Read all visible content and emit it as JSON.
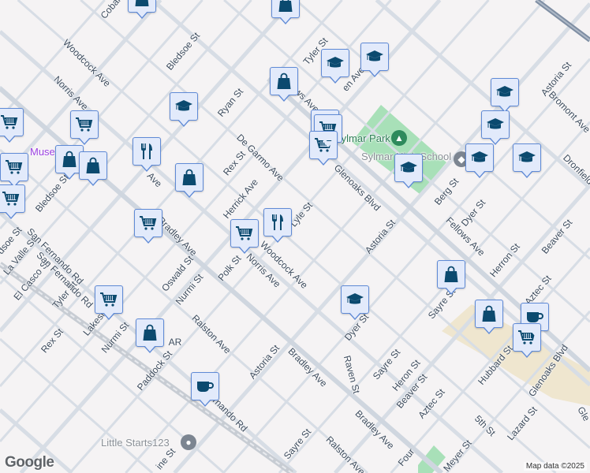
{
  "map": {
    "labels": [
      "Cobal",
      "Tyler St",
      "Bledsoe St",
      "Woodcock Ave",
      "Norris Ave",
      "Ryan St",
      "Fellows Ave",
      "en Ave",
      "Astoria St",
      "Bromont Ave",
      "Dronfield",
      "De Garmo Ave",
      "Rex St",
      "Herrick Ave",
      "Lyle St",
      "Glenoaks Blvd",
      "Berg St",
      "Dyer St",
      "Fellows Ave",
      "Astoria St",
      "Beaver St",
      "Herron St",
      "Aztec St",
      "Sayre St",
      "Woodcock Ave",
      "Norris Ave",
      "Polk St",
      "Bradley Ave",
      "Oswald St",
      "Nurmi St",
      "Ralston Ave",
      "Dyer St",
      "Astoria St",
      "Bradley Ave",
      "Raven St",
      "Sayre St",
      "Heron St",
      "Beaver St",
      "Aztec St",
      "5th St",
      "Hubbard St",
      "Glenoaks Blvd",
      "Lazard St",
      "Gle",
      "Bradley Ave",
      "Four",
      "Meyer St",
      "Sayre St",
      "Ralston Ave",
      "Paddock St",
      "San Fernando Rd",
      "Lakeside St",
      "Rex St",
      "Nurmi St",
      "Tyler St",
      "El Casco St",
      "La Valle St",
      "dsoe St",
      "San Fernando Rd",
      "San Fernando Rd",
      "Bledsoe St",
      "AR",
      "ine St",
      "Ave"
    ],
    "pois": {
      "park": "Sylmar Park",
      "school": "Sylmar High School",
      "museum": "Museum",
      "place": "Little Starts123"
    },
    "markers": [
      "shopping-bag",
      "shopping-bag",
      "graduation-cap",
      "graduation-cap",
      "shopping-bag",
      "graduation-cap",
      "graduation-cap",
      "graduation-cap",
      "shopping-cart",
      "shopping-cart",
      "shopping-cart",
      "shopping-cart",
      "shopping-cart",
      "restaurant",
      "shopping-bag",
      "shopping-bag",
      "shopping-cart",
      "shopping-cart",
      "shopping-bag",
      "graduation-cap",
      "graduation-cap",
      "graduation-cap",
      "shopping-cart",
      "restaurant",
      "shopping-cart",
      "shopping-bag",
      "graduation-cap",
      "shopping-cart",
      "shopping-bag",
      "shopping-bag",
      "coffee",
      "shopping-cart",
      "coffee"
    ],
    "logo": "Google",
    "attribution": "Map data ©2025",
    "colors": {
      "marker_bg": "#e2eafb",
      "marker_border": "#5f8ad6",
      "icon": "#0b4a6f",
      "park": "#a8e0b8",
      "industrial": "#efe6cf",
      "road": "#d3dae3"
    }
  }
}
